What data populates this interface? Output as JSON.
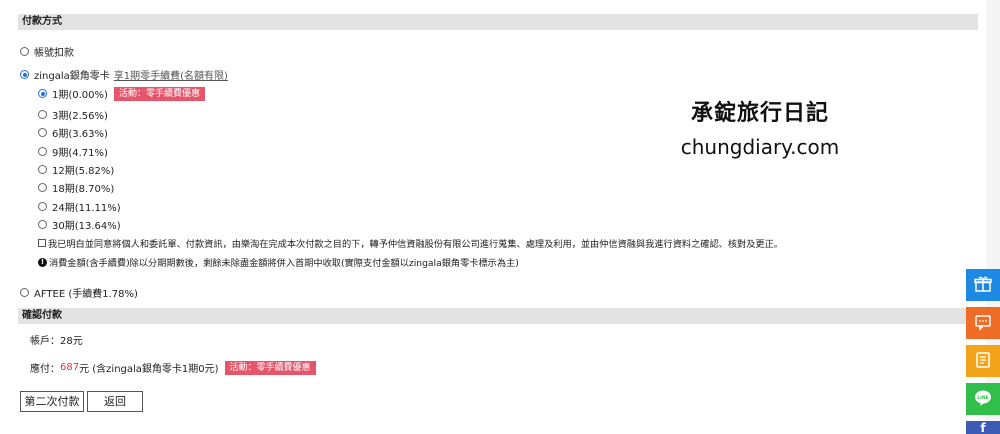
{
  "payment_header": "付款方式",
  "account_deduct": "帳號扣款",
  "zingala": {
    "label": "zingala銀角零卡",
    "promo_link": "享1期零手續費(名額有限)"
  },
  "installments": [
    {
      "label": "1期(0.00%)",
      "checked": true
    },
    {
      "label": "3期(2.56%)",
      "checked": false
    },
    {
      "label": "6期(3.63%)",
      "checked": false
    },
    {
      "label": "9期(4.71%)",
      "checked": false
    },
    {
      "label": "12期(5.82%)",
      "checked": false
    },
    {
      "label": "18期(8.70%)",
      "checked": false
    },
    {
      "label": "24期(11.11%)",
      "checked": false
    },
    {
      "label": "30期(13.64%)",
      "checked": false
    }
  ],
  "promo_badge": "活動：零手續費優惠",
  "consent_text": "我已明白並同意將個人和委託單、付款資訊，由樂淘在完成本次付款之目的下，轉予仲信資融股份有限公司進行蒐集、處理及利用，並由仲信資融與我進行資料之確認、核對及更正。",
  "note_text": "消費金額(含手續費)除以分期期數後，剩餘未除盡金額將併入首期中收取(實際支付金額以zingala銀角零卡標示為主)",
  "aftee": "AFTEE (手續費1.78%)",
  "confirm_header": "確認付款",
  "account_line": "帳戶：28元",
  "payable": {
    "prefix": "應付：",
    "amount": "687",
    "suffix": "元 (含zingala銀角零卡1期0元)"
  },
  "buttons": {
    "pay": "第二次付款",
    "back": "返回"
  },
  "watermark": {
    "line1": "承錠旅行日記",
    "line2": "chungdiary.com"
  },
  "colors": {
    "badge": "#e5566b",
    "amount": "#e5323e",
    "side_blue": "#1e88e5",
    "side_orange": "#ef6c27",
    "side_yellow": "#f3a41b",
    "side_green": "#2fbf4a"
  },
  "side_icons": [
    "gift-icon",
    "chat-icon",
    "book-icon",
    "line-icon",
    "facebook-icon"
  ]
}
